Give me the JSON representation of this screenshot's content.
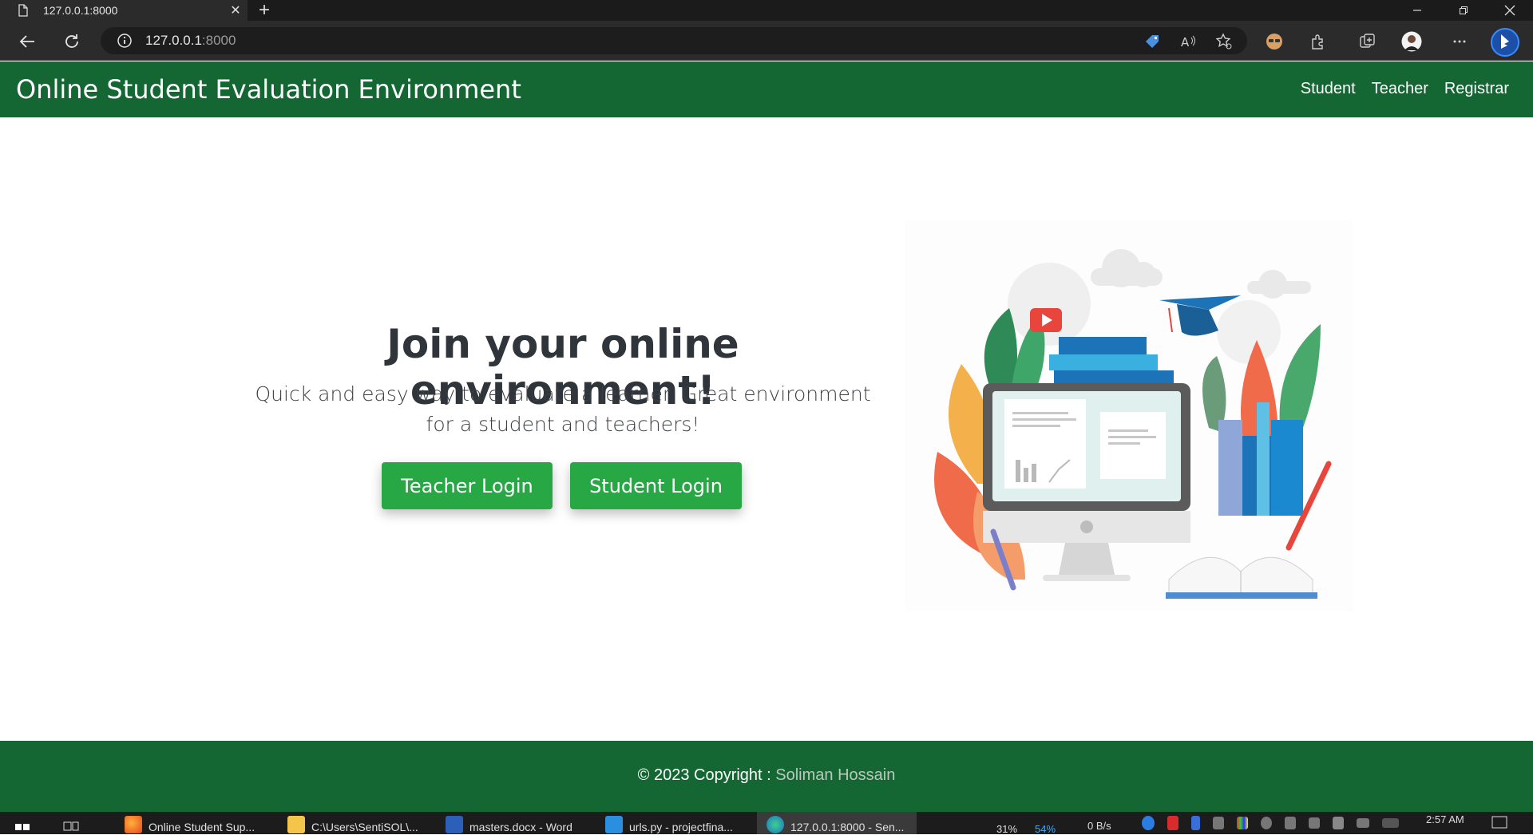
{
  "browser": {
    "tab_title": "127.0.0.1:8000",
    "tab_close": "✕",
    "new_tab": "+",
    "url_host": "127.0.0.1",
    "url_port": ":8000"
  },
  "site": {
    "brand": "Online Student Evaluation Environment",
    "nav": [
      "Student",
      "Teacher",
      "Registrar"
    ]
  },
  "hero": {
    "title": "Join your online environment!",
    "subtitle": "Quick and easy way to evaluate a learner. Great environment for a student and teachers!",
    "teacher_button": "Teacher Login",
    "student_button": "Student Login"
  },
  "footer": {
    "prefix": "© 2023 Copyright : ",
    "author": "Soliman Hossain"
  },
  "taskbar": {
    "items": [
      "Online Student Sup...",
      "C:\\Users\\SentiSOL\\...",
      "masters.docx - Word",
      "urls.py - projectfina...",
      "127.0.0.1:8000 - Sen..."
    ],
    "battery": "31%",
    "cpu": "54%",
    "net": "0 B/s",
    "time": "2:57 AM"
  },
  "colors": {
    "nav_green": "#146633",
    "button_green": "#28a745"
  }
}
